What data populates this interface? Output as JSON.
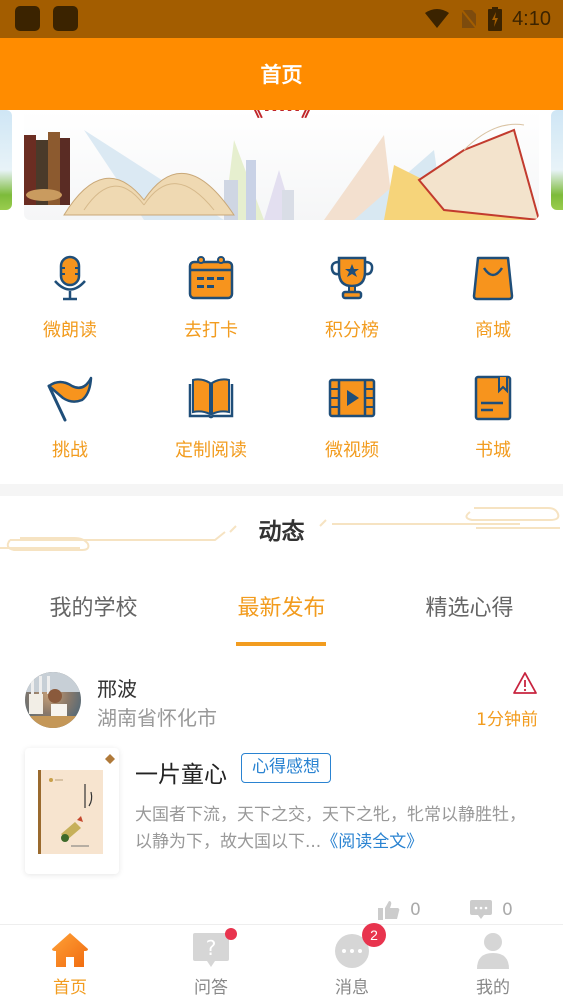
{
  "status_bar": {
    "time": "4:10",
    "icons": [
      "app-icon",
      "app-icon",
      "wifi-icon",
      "no-sim-icon",
      "battery-charging-icon"
    ]
  },
  "header": {
    "title": "首页"
  },
  "banner": {
    "icons": [
      "books-illustration"
    ]
  },
  "grid": {
    "items": [
      {
        "label": "微朗读",
        "icon": "microphone-icon"
      },
      {
        "label": "去打卡",
        "icon": "calendar-icon"
      },
      {
        "label": "积分榜",
        "icon": "trophy-icon"
      },
      {
        "label": "商城",
        "icon": "shopping-bag-icon"
      },
      {
        "label": "挑战",
        "icon": "flag-icon"
      },
      {
        "label": "定制阅读",
        "icon": "open-book-icon"
      },
      {
        "label": "微视频",
        "icon": "video-icon"
      },
      {
        "label": "书城",
        "icon": "bookmark-book-icon"
      }
    ]
  },
  "section": {
    "title": "动态"
  },
  "tabs": {
    "items": [
      "我的学校",
      "最新发布",
      "精选心得"
    ],
    "active": "最新发布"
  },
  "post": {
    "author": "邢波",
    "location": "湖南省怀化市",
    "time": "1分钟前",
    "title": "一片童心",
    "tag": "心得感想",
    "excerpt": "大国者下流，天下之交，天下之牝，牝常以静胜牡，以静为下，故大国以下...",
    "read_more": "《阅读全文》",
    "likes": "0",
    "comments": "0"
  },
  "bottom_nav": {
    "items": [
      {
        "label": "首页",
        "icon": "home-icon",
        "active": true
      },
      {
        "label": "问答",
        "icon": "question-icon",
        "dot": true
      },
      {
        "label": "消息",
        "icon": "message-icon",
        "badge": "2"
      },
      {
        "label": "我的",
        "icon": "profile-icon"
      }
    ]
  },
  "colors": {
    "primary": "#ff8c00",
    "accent_text": "#f29c1f",
    "icon_stroke": "#1f4e79",
    "link": "#2a83d1",
    "badge": "#e8344e"
  }
}
